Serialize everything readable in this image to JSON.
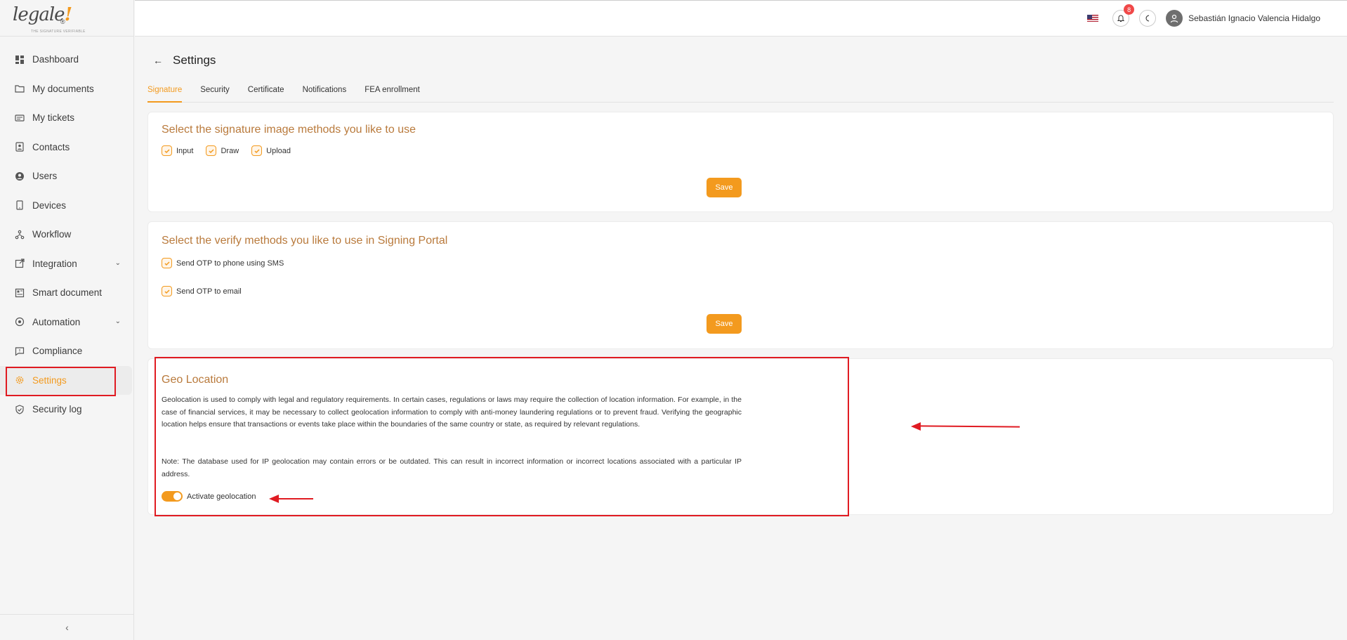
{
  "logo": {
    "text": "legale",
    "bang": "!",
    "reg": "®",
    "tagline": "THE SIGNATURE VERIFIABLE"
  },
  "sidebar": {
    "items": [
      {
        "label": "Dashboard",
        "icon": "dashboard-icon"
      },
      {
        "label": "My documents",
        "icon": "folder-icon"
      },
      {
        "label": "My tickets",
        "icon": "ticket-icon"
      },
      {
        "label": "Contacts",
        "icon": "contacts-icon"
      },
      {
        "label": "Users",
        "icon": "user-circle-icon"
      },
      {
        "label": "Devices",
        "icon": "device-icon"
      },
      {
        "label": "Workflow",
        "icon": "workflow-icon"
      },
      {
        "label": "Integration",
        "icon": "external-link-icon"
      },
      {
        "label": "Smart document",
        "icon": "smart-doc-icon"
      },
      {
        "label": "Automation",
        "icon": "automation-icon"
      },
      {
        "label": "Compliance",
        "icon": "message-icon"
      },
      {
        "label": "Settings",
        "icon": "gear-icon"
      },
      {
        "label": "Security log",
        "icon": "shield-icon"
      }
    ],
    "collapse": "‹"
  },
  "topbar": {
    "notifications_count": "8",
    "username": "Sebastián Ignacio Valencia Hidalgo"
  },
  "page": {
    "back": "←",
    "title": "Settings",
    "tabs": [
      "Signature",
      "Security",
      "Certificate",
      "Notifications",
      "FEA enrollment"
    ]
  },
  "signature_card": {
    "title": "Select the signature image methods you like to use",
    "options": [
      "Input",
      "Draw",
      "Upload"
    ],
    "save": "Save"
  },
  "verify_card": {
    "title": "Select the verify methods you like to use in Signing Portal",
    "options": [
      "Send OTP to phone using SMS",
      "Send OTP to email"
    ],
    "save": "Save"
  },
  "geo_card": {
    "title": "Geo Location",
    "description": "Geolocation is used to comply with legal and regulatory requirements. In certain cases, regulations or laws may require the collection of location information. For example, in the case of financial services, it may be necessary to collect geolocation information to comply with anti-money laundering regulations or to prevent fraud. Verifying the geographic location helps ensure that transactions or events take place within the boundaries of the same country or state, as required by relevant regulations.",
    "note": "Note: The database used for IP geolocation may contain errors or be outdated. This can result in incorrect information or incorrect locations associated with a particular IP address.",
    "toggle_label": "Activate geolocation"
  },
  "colors": {
    "accent": "#f39a1e",
    "annotation": "#e01b22",
    "title": "#b97a3c"
  }
}
